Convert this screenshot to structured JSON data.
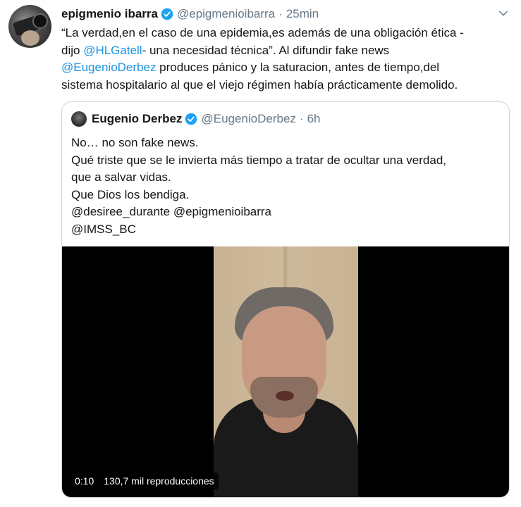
{
  "tweet": {
    "author_name": "epigmenio ibarra",
    "author_handle": "@epigmenioibarra",
    "separator": "·",
    "time": "25min",
    "text": {
      "l1": "“La verdad,en el caso de una epidemia,es además de una obligación ética -",
      "l2_pre": "dijo ",
      "l2_mention": "@HLGatell",
      "l2_post": "- una necesidad técnica”. Al difundir fake news",
      "l3_mention": "@EugenioDerbez",
      "l3_post": " produces pánico y la saturacion, antes de tiempo,del",
      "l4": "sistema hospitalario al que el viejo régimen había prácticamente demolido."
    }
  },
  "quoted": {
    "author_name": "Eugenio Derbez",
    "author_handle": "@EugenioDerbez",
    "separator": "·",
    "time": "6h",
    "lines": [
      "No… no son fake news.",
      "Qué triste que se le invierta más tiempo a tratar de ocultar una verdad,",
      "que a salvar vidas.",
      "Que Dios los bendiga.",
      "@desiree_durante @epigmenioibarra",
      "@IMSS_BC"
    ],
    "video": {
      "duration": "0:10",
      "views": "130,7 mil reproducciones"
    }
  },
  "icons": {
    "verified": "verified-badge-icon",
    "caret": "chevron-down-icon"
  },
  "colors": {
    "mention": "#1b95e0",
    "verified": "#1da1f2",
    "secondary_text": "#657786",
    "border": "#ccd6dd"
  }
}
